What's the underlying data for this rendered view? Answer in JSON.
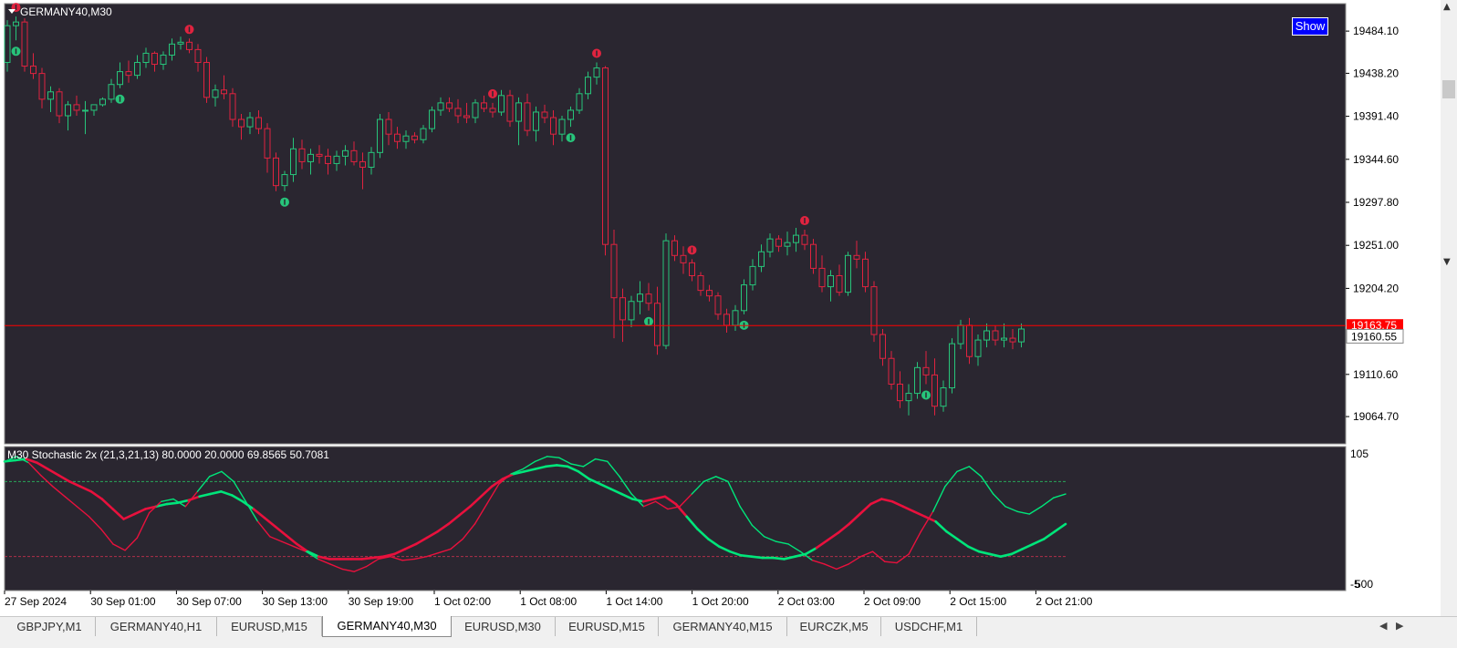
{
  "chart_data": {
    "type": "candlestick",
    "symbol_label": "GERMANY40,M30",
    "price_ticks": [
      "19484.10",
      "19438.20",
      "19391.40",
      "19344.60",
      "19297.80",
      "19251.00",
      "19204.20",
      "19110.60",
      "19064.70"
    ],
    "ylim": [
      19040,
      19510
    ],
    "current_price_label": "19160.55",
    "current_price": 19160.55,
    "hidden_price_label": "19163.75",
    "hidden_price": 19163.75,
    "ohlc": [
      [
        19450,
        19496,
        19440,
        19490
      ],
      [
        19490,
        19500,
        19474,
        19494
      ],
      [
        19494,
        19498,
        19440,
        19446
      ],
      [
        19446,
        19460,
        19432,
        19438
      ],
      [
        19438,
        19444,
        19400,
        19410
      ],
      [
        19410,
        19424,
        19396,
        19418
      ],
      [
        19418,
        19422,
        19384,
        19392
      ],
      [
        19392,
        19408,
        19376,
        19404
      ],
      [
        19404,
        19414,
        19392,
        19398
      ],
      [
        19398,
        19408,
        19372,
        19398
      ],
      [
        19398,
        19404,
        19392,
        19404
      ],
      [
        19404,
        19412,
        19402,
        19410
      ],
      [
        19410,
        19432,
        19406,
        19426
      ],
      [
        19426,
        19450,
        19422,
        19440
      ],
      [
        19440,
        19452,
        19428,
        19436
      ],
      [
        19436,
        19458,
        19432,
        19450
      ],
      [
        19450,
        19466,
        19444,
        19460
      ],
      [
        19460,
        19462,
        19440,
        19448
      ],
      [
        19448,
        19462,
        19442,
        19458
      ],
      [
        19458,
        19476,
        19452,
        19470
      ],
      [
        19470,
        19478,
        19464,
        19472
      ],
      [
        19472,
        19476,
        19460,
        19464
      ],
      [
        19464,
        19470,
        19440,
        19450
      ],
      [
        19450,
        19456,
        19406,
        19412
      ],
      [
        19412,
        19426,
        19402,
        19420
      ],
      [
        19420,
        19436,
        19410,
        19416
      ],
      [
        19416,
        19422,
        19380,
        19388
      ],
      [
        19388,
        19394,
        19366,
        19380
      ],
      [
        19380,
        19396,
        19372,
        19390
      ],
      [
        19390,
        19398,
        19372,
        19378
      ],
      [
        19378,
        19384,
        19330,
        19346
      ],
      [
        19346,
        19352,
        19310,
        19316
      ],
      [
        19316,
        19332,
        19310,
        19328
      ],
      [
        19328,
        19368,
        19320,
        19356
      ],
      [
        19356,
        19366,
        19334,
        19342
      ],
      [
        19342,
        19356,
        19328,
        19350
      ],
      [
        19350,
        19360,
        19340,
        19348
      ],
      [
        19348,
        19356,
        19328,
        19340
      ],
      [
        19340,
        19354,
        19332,
        19348
      ],
      [
        19348,
        19360,
        19338,
        19354
      ],
      [
        19354,
        19364,
        19338,
        19342
      ],
      [
        19342,
        19352,
        19312,
        19336
      ],
      [
        19336,
        19358,
        19328,
        19352
      ],
      [
        19352,
        19394,
        19346,
        19388
      ],
      [
        19388,
        19396,
        19360,
        19372
      ],
      [
        19372,
        19380,
        19356,
        19364
      ],
      [
        19364,
        19376,
        19356,
        19370
      ],
      [
        19370,
        19374,
        19362,
        19366
      ],
      [
        19366,
        19382,
        19362,
        19378
      ],
      [
        19378,
        19402,
        19374,
        19398
      ],
      [
        19398,
        19412,
        19392,
        19406
      ],
      [
        19406,
        19412,
        19396,
        19400
      ],
      [
        19400,
        19410,
        19384,
        19392
      ],
      [
        19392,
        19406,
        19384,
        19390
      ],
      [
        19390,
        19410,
        19384,
        19406
      ],
      [
        19406,
        19414,
        19396,
        19400
      ],
      [
        19400,
        19406,
        19390,
        19396
      ],
      [
        19396,
        19420,
        19392,
        19414
      ],
      [
        19414,
        19420,
        19380,
        19386
      ],
      [
        19386,
        19412,
        19360,
        19406
      ],
      [
        19406,
        19416,
        19370,
        19376
      ],
      [
        19376,
        19402,
        19364,
        19396
      ],
      [
        19396,
        19404,
        19384,
        19390
      ],
      [
        19390,
        19398,
        19360,
        19372
      ],
      [
        19372,
        19392,
        19364,
        19388
      ],
      [
        19388,
        19402,
        19380,
        19398
      ],
      [
        19398,
        19422,
        19394,
        19416
      ],
      [
        19416,
        19440,
        19410,
        19434
      ],
      [
        19434,
        19450,
        19426,
        19444
      ],
      [
        19444,
        19446,
        19240,
        19252
      ],
      [
        19252,
        19268,
        19150,
        19194
      ],
      [
        19194,
        19204,
        19146,
        19170
      ],
      [
        19170,
        19196,
        19162,
        19190
      ],
      [
        19190,
        19212,
        19176,
        19198
      ],
      [
        19198,
        19210,
        19180,
        19188
      ],
      [
        19188,
        19206,
        19132,
        19142
      ],
      [
        19142,
        19264,
        19138,
        19256
      ],
      [
        19256,
        19262,
        19234,
        19240
      ],
      [
        19240,
        19250,
        19220,
        19232
      ],
      [
        19232,
        19236,
        19212,
        19218
      ],
      [
        19218,
        19222,
        19196,
        19202
      ],
      [
        19202,
        19208,
        19190,
        19196
      ],
      [
        19196,
        19200,
        19170,
        19176
      ],
      [
        19176,
        19182,
        19156,
        19164
      ],
      [
        19164,
        19186,
        19158,
        19180
      ],
      [
        19180,
        19214,
        19176,
        19208
      ],
      [
        19208,
        19236,
        19202,
        19228
      ],
      [
        19228,
        19252,
        19222,
        19244
      ],
      [
        19244,
        19264,
        19238,
        19258
      ],
      [
        19258,
        19262,
        19244,
        19250
      ],
      [
        19250,
        19266,
        19240,
        19254
      ],
      [
        19254,
        19270,
        19244,
        19262
      ],
      [
        19262,
        19268,
        19246,
        19252
      ],
      [
        19252,
        19258,
        19220,
        19226
      ],
      [
        19226,
        19240,
        19200,
        19206
      ],
      [
        19206,
        19224,
        19190,
        19218
      ],
      [
        19218,
        19230,
        19196,
        19200
      ],
      [
        19200,
        19244,
        19196,
        19240
      ],
      [
        19240,
        19256,
        19226,
        19236
      ],
      [
        19236,
        19244,
        19200,
        19206
      ],
      [
        19206,
        19212,
        19146,
        19154
      ],
      [
        19154,
        19160,
        19120,
        19128
      ],
      [
        19128,
        19136,
        19094,
        19100
      ],
      [
        19100,
        19114,
        19074,
        19082
      ],
      [
        19082,
        19100,
        19066,
        19090
      ],
      [
        19090,
        19124,
        19084,
        19118
      ],
      [
        19118,
        19136,
        19100,
        19110
      ],
      [
        19110,
        19128,
        19066,
        19076
      ],
      [
        19076,
        19104,
        19070,
        19096
      ],
      [
        19096,
        19150,
        19090,
        19144
      ],
      [
        19144,
        19170,
        19138,
        19164
      ],
      [
        19164,
        19172,
        19122,
        19130
      ],
      [
        19130,
        19154,
        19120,
        19148
      ],
      [
        19148,
        19166,
        19140,
        19158
      ],
      [
        19158,
        19164,
        19142,
        19148
      ],
      [
        19148,
        19166,
        19140,
        19150
      ],
      [
        19150,
        19160,
        19138,
        19146
      ],
      [
        19146,
        19166,
        19140,
        19160
      ]
    ],
    "up_arrow_bars": [
      1,
      13,
      32,
      65,
      74,
      85,
      106
    ],
    "down_arrow_bars": [
      1,
      21,
      56,
      68,
      79,
      92
    ],
    "time_labels": [
      "27 Sep 2024",
      "30 Sep 01:00",
      "30 Sep 07:00",
      "30 Sep 13:00",
      "30 Sep 19:00",
      "1 Oct 02:00",
      "1 Oct 08:00",
      "1 Oct 14:00",
      "1 Oct 20:00",
      "2 Oct 03:00",
      "2 Oct 09:00",
      "2 Oct 15:00",
      "2 Oct 21:00"
    ],
    "indicator": {
      "label": "M30 Stochastic 2x (21,3,21,13) 80.0000 20.0000 69.8565 50.7081",
      "levels": [
        80,
        20
      ],
      "scale_labels": [
        "105",
        "-5",
        "500"
      ],
      "ylim": [
        -5,
        105
      ],
      "fast_line": [
        96,
        100,
        95,
        85,
        76,
        68,
        60,
        52,
        42,
        30,
        25,
        35,
        55,
        64,
        66,
        60,
        72,
        84,
        88,
        80,
        64,
        48,
        36,
        32,
        28,
        24,
        18,
        14,
        10,
        8,
        12,
        18,
        20,
        17,
        18,
        20,
        23,
        26,
        34,
        46,
        62,
        78,
        86,
        90,
        96,
        100,
        99,
        94,
        92,
        98,
        96,
        84,
        70,
        60,
        64,
        58,
        60,
        70,
        80,
        84,
        80,
        60,
        45,
        36,
        32,
        30,
        24,
        17,
        14,
        10,
        14,
        20,
        24,
        16,
        15,
        22,
        40,
        56,
        76,
        88,
        92,
        84,
        70,
        60,
        56,
        54,
        60,
        67,
        70
      ],
      "slow_line": [
        96,
        97,
        98,
        95,
        90,
        85,
        80,
        76,
        72,
        66,
        58,
        50,
        54,
        58,
        60,
        62,
        63,
        65,
        68,
        70,
        72,
        69,
        64,
        58,
        51,
        44,
        37,
        30,
        24,
        20,
        18,
        18,
        18,
        18,
        19,
        20,
        22,
        26,
        30,
        35,
        40,
        46,
        53,
        60,
        68,
        76,
        82,
        86,
        88,
        90,
        92,
        93,
        92,
        88,
        82,
        78,
        74,
        70,
        66,
        64,
        66,
        68,
        62,
        52,
        42,
        34,
        28,
        24,
        21,
        20,
        19,
        19,
        18,
        20,
        22,
        27,
        33,
        39,
        46,
        54,
        62,
        66,
        64,
        60,
        56,
        52,
        48,
        40,
        34,
        28,
        24,
        22,
        20,
        22,
        26,
        30,
        34,
        40,
        46
      ]
    }
  },
  "tabs": [
    "GBPJPY,M1",
    "GERMANY40,H1",
    "EURUSD,M15",
    "GERMANY40,M30",
    "EURUSD,M30",
    "EURUSD,M15",
    "GERMANY40,M15",
    "EURCZK,M5",
    "USDCHF,M1"
  ],
  "active_tab": 3,
  "show_button_label": "Show",
  "colors": {
    "background": "#2a2630",
    "bull_candle": "#27c47a",
    "bear_candle": "#e0233f",
    "price_line": "#ff0000",
    "fast_line": "#00e57a",
    "slow_line": "#e8113d"
  },
  "icons": [
    "dropdown-triangle-icon",
    "down-arrow-signal-icon",
    "up-arrow-signal-icon",
    "scroll-left-icon",
    "scroll-right-icon",
    "scroll-up-icon",
    "scroll-down-icon"
  ]
}
